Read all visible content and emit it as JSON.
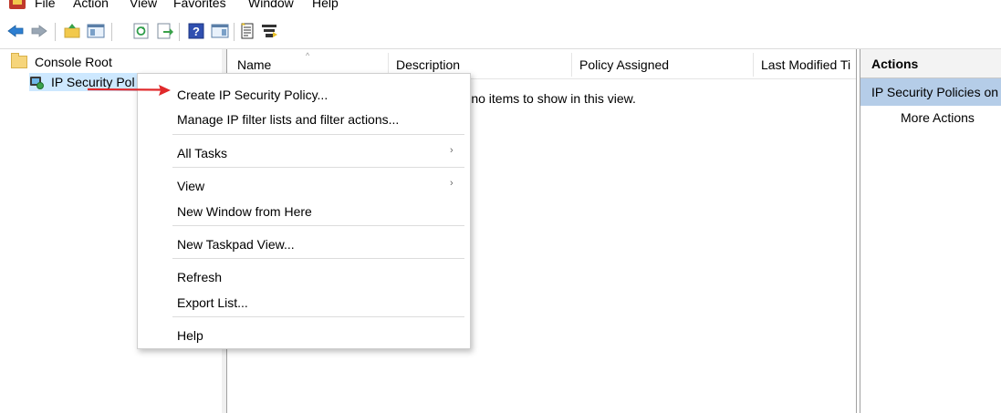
{
  "menubar": {
    "items": [
      "File",
      "Action",
      "View",
      "Favorites",
      "Window",
      "Help"
    ]
  },
  "toolbar": {
    "buttons": [
      "back-icon",
      "forward-icon",
      "up-folder-icon",
      "show-hide-tree-icon",
      "refresh-icon",
      "export-list-icon",
      "help-icon",
      "show-hide-action-pane-icon",
      "create-policy-icon",
      "manage-filters-icon"
    ]
  },
  "tree": {
    "root_label": "Console Root",
    "child_label": "IP Security Pol"
  },
  "list": {
    "columns": [
      "Name",
      "Description",
      "Policy Assigned",
      "Last Modified Ti"
    ],
    "empty_message": "re no items to show in this view."
  },
  "actions": {
    "title": "Actions",
    "group": "IP Security Policies on",
    "more": "More Actions"
  },
  "context_menu": {
    "items": [
      "Create IP Security Policy...",
      "Manage IP filter lists and filter actions...",
      "All Tasks",
      "View",
      "New Window from Here",
      "New Taskpad View...",
      "Refresh",
      "Export List...",
      "Help"
    ],
    "submenu_glyph": "›"
  },
  "colors": {
    "selection": "#cde8ff",
    "actions_group": "#b5cde8",
    "arrow": "#e0292b"
  }
}
